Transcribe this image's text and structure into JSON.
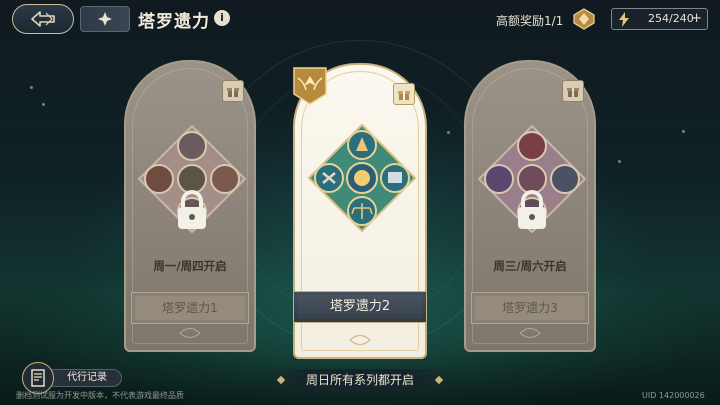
{
  "header": {
    "title": "塔罗遗力",
    "reward_text": "高额奖励1/1",
    "energy": "254/240",
    "energy_plus": "+"
  },
  "cards": [
    {
      "name": "塔罗遗力1",
      "days": "周一/周四开启",
      "locked": true
    },
    {
      "name": "塔罗遗力2",
      "days": "",
      "locked": false,
      "selected": true
    },
    {
      "name": "塔罗遗力3",
      "days": "周三/周六开启",
      "locked": true
    }
  ],
  "footer": {
    "banner": "周日所有系列都开启",
    "proxy_label": "代行记录",
    "disclaimer": "删档测试服为开发中版本，不代表游戏最终品质",
    "uid": "UID 142000026"
  },
  "colors": {
    "accent_gold": "#c9b27a",
    "panel_dark": "#1c2731",
    "card_light": "#f6f1e5",
    "card_grey": "#8a8279"
  },
  "icons": [
    "back-arrow-icon",
    "grid-menu-icon",
    "info-icon",
    "reward-wings-icon",
    "energy-bolt-icon",
    "gift-icon",
    "lock-icon",
    "winged-emblem-icon",
    "proxy-record-icon"
  ]
}
